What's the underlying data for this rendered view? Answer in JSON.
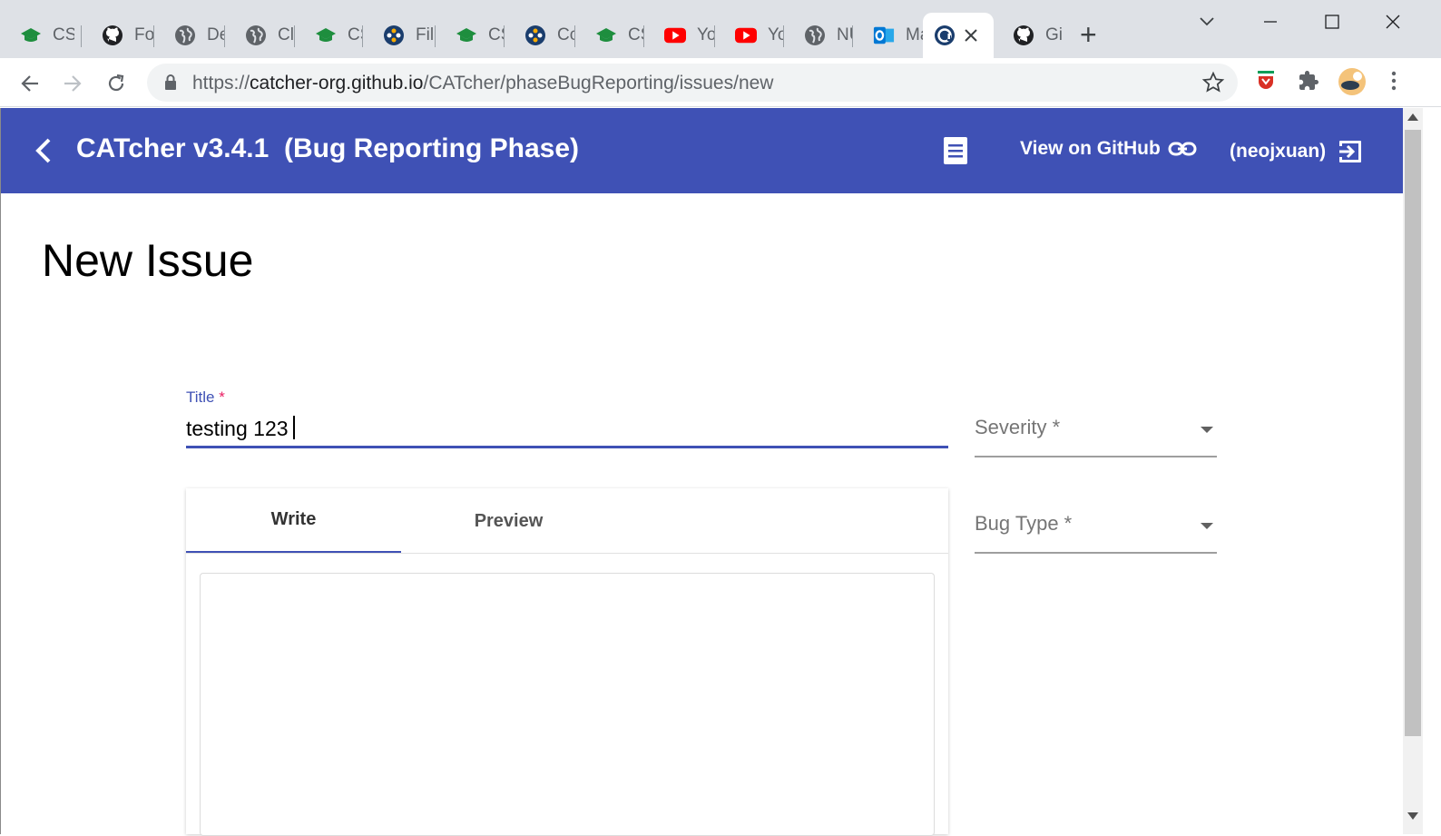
{
  "tabs": [
    {
      "title": "CS",
      "icon": "graduation-cap-icon"
    },
    {
      "title": "Fo",
      "icon": "github-icon"
    },
    {
      "title": "De",
      "icon": "globe-icon"
    },
    {
      "title": "Cl",
      "icon": "globe-icon"
    },
    {
      "title": "CS",
      "icon": "graduation-cap-icon"
    },
    {
      "title": "Fil",
      "icon": "app-icon"
    },
    {
      "title": "CS",
      "icon": "graduation-cap-icon"
    },
    {
      "title": "Cc",
      "icon": "app-icon"
    },
    {
      "title": "CS",
      "icon": "graduation-cap-icon"
    },
    {
      "title": "Yo",
      "icon": "youtube-icon"
    },
    {
      "title": "Yo",
      "icon": "youtube-icon"
    },
    {
      "title": "NU",
      "icon": "globe-icon"
    },
    {
      "title": "Ma",
      "icon": "outlook-icon"
    },
    {
      "title": "",
      "icon": "catcher-icon",
      "active": true
    },
    {
      "title": "Gi",
      "icon": "github-icon"
    }
  ],
  "address": {
    "scheme": "https://",
    "host": "catcher-org.github.io",
    "path": "/CATcher/phaseBugReporting/issues/new"
  },
  "app": {
    "title": "CATcher v3.4.1  (Bug Reporting Phase)",
    "github_link": "View on GitHub",
    "user": "(neojxuan)",
    "brand_color": "#3f51b5"
  },
  "page": {
    "heading": "New Issue",
    "title_label": "Title",
    "required_mark": "*",
    "title_value": "testing 123",
    "severity_placeholder": "Severity *",
    "bugtype_placeholder": "Bug Type *",
    "tab_write": "Write",
    "tab_preview": "Preview"
  }
}
